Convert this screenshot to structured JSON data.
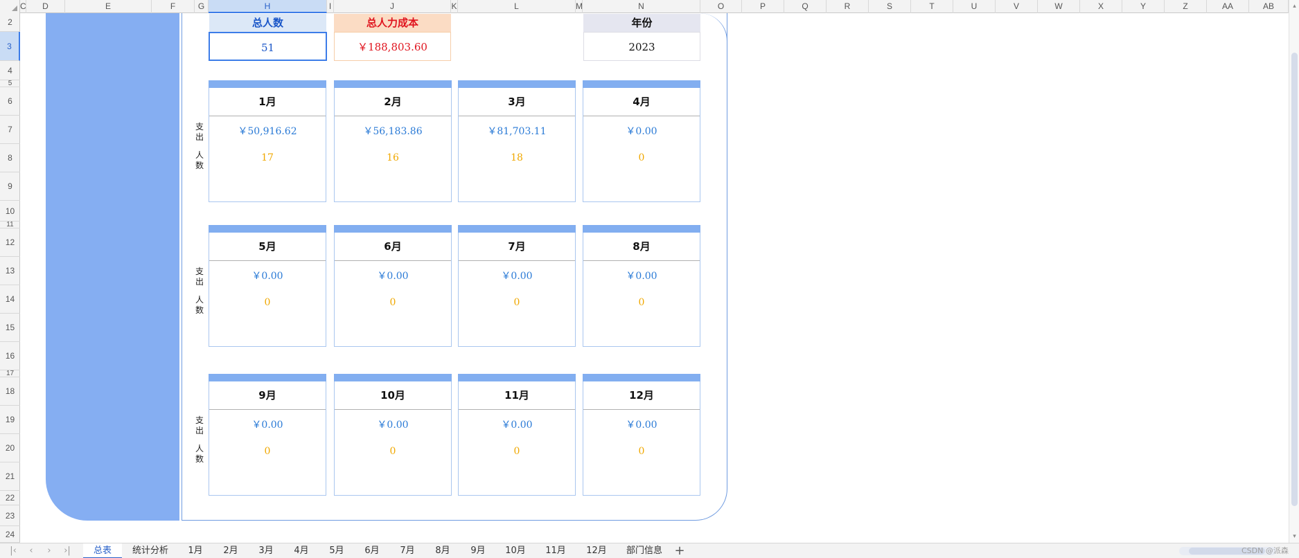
{
  "column_headers": [
    "C",
    "D",
    "E",
    "F",
    "G",
    "H",
    "I",
    "J",
    "K",
    "L",
    "M",
    "N",
    "O",
    "P",
    "Q",
    "R",
    "S",
    "T",
    "U",
    "V",
    "W",
    "X",
    "Y",
    "Z",
    "AA",
    "AB"
  ],
  "row_headers": [
    "2",
    "3",
    "4",
    "5",
    "6",
    "7",
    "8",
    "9",
    "10",
    "11",
    "12",
    "13",
    "14",
    "15",
    "16",
    "17",
    "18",
    "19",
    "20",
    "21",
    "22",
    "23",
    "24"
  ],
  "active_cell": {
    "column": "H",
    "row": "3"
  },
  "summary": {
    "total_people_label": "总人数",
    "total_people_value": "51",
    "total_cost_label": "总人力成本",
    "total_cost_value": "￥188,803.60",
    "year_label": "年份",
    "year_value": "2023"
  },
  "side_labels": {
    "expense": "支出",
    "people": "人数"
  },
  "months": [
    {
      "name": "1月",
      "amount": "￥50,916.62",
      "count": "17"
    },
    {
      "name": "2月",
      "amount": "￥56,183.86",
      "count": "16"
    },
    {
      "name": "3月",
      "amount": "￥81,703.11",
      "count": "18"
    },
    {
      "name": "4月",
      "amount": "￥0.00",
      "count": "0"
    },
    {
      "name": "5月",
      "amount": "￥0.00",
      "count": "0"
    },
    {
      "name": "6月",
      "amount": "￥0.00",
      "count": "0"
    },
    {
      "name": "7月",
      "amount": "￥0.00",
      "count": "0"
    },
    {
      "name": "8月",
      "amount": "￥0.00",
      "count": "0"
    },
    {
      "name": "9月",
      "amount": "￥0.00",
      "count": "0"
    },
    {
      "name": "10月",
      "amount": "￥0.00",
      "count": "0"
    },
    {
      "name": "11月",
      "amount": "￥0.00",
      "count": "0"
    },
    {
      "name": "12月",
      "amount": "￥0.00",
      "count": "0"
    }
  ],
  "sheet_tabs": [
    "总表",
    "统计分析",
    "1月",
    "2月",
    "3月",
    "4月",
    "5月",
    "6月",
    "7月",
    "8月",
    "9月",
    "10月",
    "11月",
    "12月",
    "部门信息"
  ],
  "active_tab": "总表",
  "nav_buttons": [
    "first-sheet",
    "prev-sheet",
    "next-sheet",
    "last-sheet"
  ],
  "watermark": "CSDN @派森",
  "colors": {
    "panel_blue": "#85aef2",
    "card_bar_blue": "#82aef0",
    "amount_blue": "#2a7ad6",
    "count_orange": "#f0a800",
    "cost_red": "#e0141e",
    "people_blue": "#1a56c8"
  }
}
